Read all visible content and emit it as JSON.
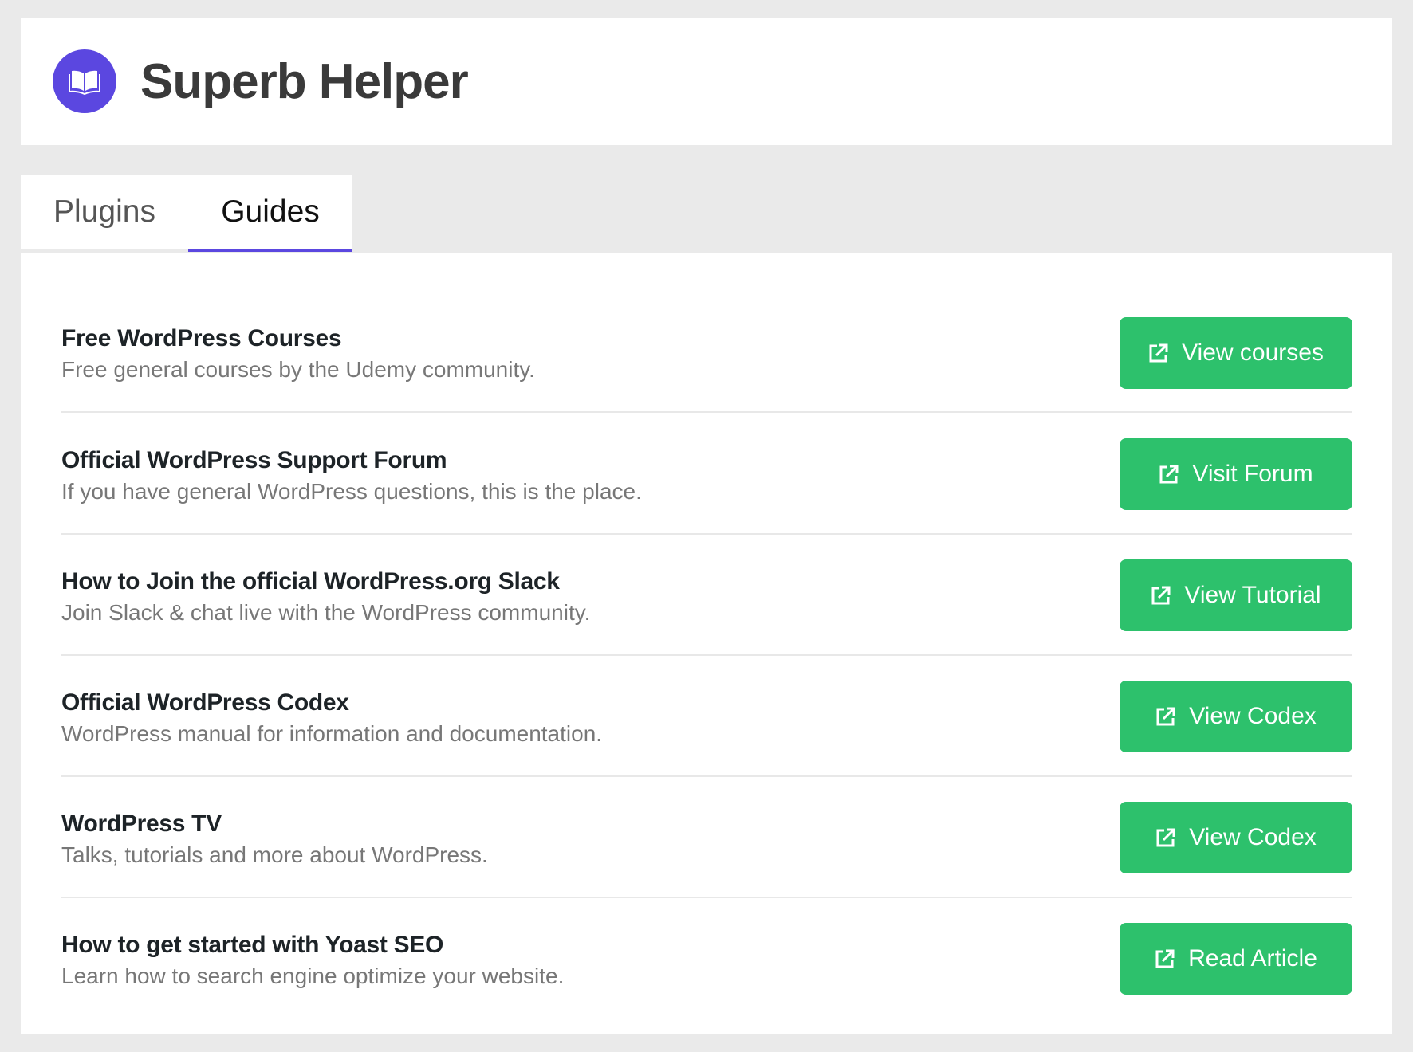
{
  "header": {
    "title": "Superb Helper",
    "logo_icon": "open-book-icon",
    "accent_color": "#5b47e0"
  },
  "tabs": [
    {
      "label": "Plugins",
      "active": false
    },
    {
      "label": "Guides",
      "active": true
    }
  ],
  "guides": [
    {
      "title": "Free WordPress Courses",
      "description": "Free general courses by the Udemy community.",
      "button": "View courses",
      "icon": "external-link-icon"
    },
    {
      "title": "Official WordPress Support Forum",
      "description": "If you have general WordPress questions, this is the place.",
      "button": "Visit Forum",
      "icon": "external-link-icon"
    },
    {
      "title": "How to Join the official WordPress.org Slack",
      "description": "Join Slack & chat live with the WordPress community.",
      "button": "View Tutorial",
      "icon": "external-link-icon"
    },
    {
      "title": "Official WordPress Codex",
      "description": "WordPress manual for information and documentation.",
      "button": "View Codex",
      "icon": "external-link-icon"
    },
    {
      "title": "WordPress TV",
      "description": "Talks, tutorials and more about WordPress.",
      "button": "View Codex",
      "icon": "external-link-icon"
    },
    {
      "title": "How to get started with Yoast SEO",
      "description": "Learn how to search engine optimize your website.",
      "button": "Read Article",
      "icon": "external-link-icon"
    }
  ],
  "colors": {
    "button_bg": "#2dc16c",
    "page_bg": "#eaeaea"
  }
}
